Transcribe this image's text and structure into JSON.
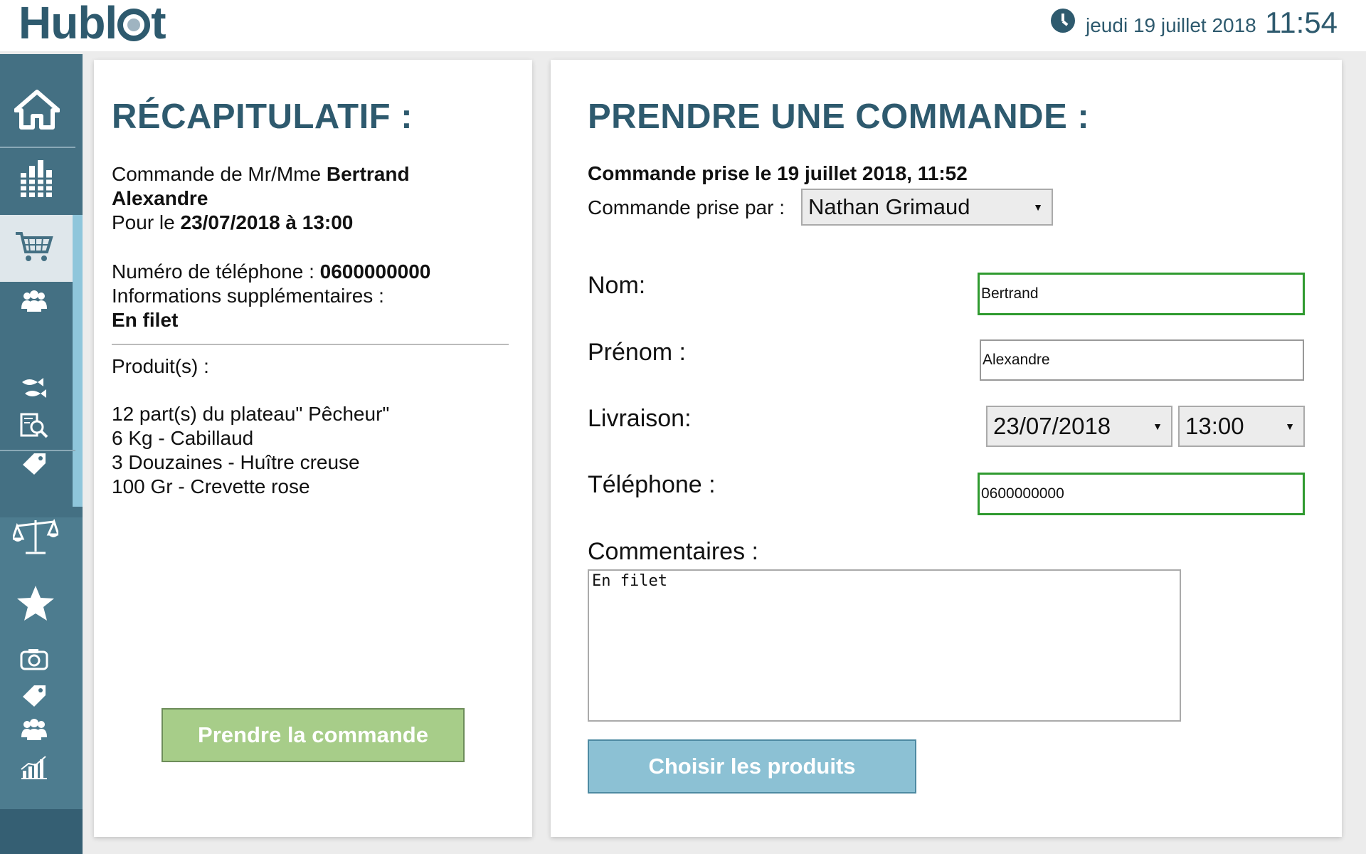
{
  "header": {
    "logo": "Hublot",
    "date": "jeudi 19 juillet 2018",
    "time": "11:54"
  },
  "sidebar": {
    "items": [
      {
        "icon": "home-icon",
        "label": "Accueil"
      },
      {
        "icon": "stats-icon",
        "label": "Statistiques"
      },
      {
        "icon": "cart-icon",
        "label": "Commandes"
      },
      {
        "icon": "clients-icon",
        "label": "Clients"
      },
      {
        "icon": "fish-icon",
        "label": "Produits"
      },
      {
        "icon": "search-doc-icon",
        "label": "Recherche"
      },
      {
        "icon": "tag-icon",
        "label": "Prix"
      },
      {
        "icon": "scale-icon",
        "label": "Balance"
      },
      {
        "icon": "star-icon",
        "label": "Favoris"
      },
      {
        "icon": "camera-icon",
        "label": "Photo"
      },
      {
        "icon": "tag2-icon",
        "label": "Étiquettes"
      },
      {
        "icon": "users-icon",
        "label": "Utilisateurs"
      },
      {
        "icon": "chart-icon",
        "label": "Graphiques"
      }
    ]
  },
  "summary": {
    "title": "RÉCAPITULATIF :",
    "order_prefix": "Commande de Mr/Mme ",
    "customer_name_line1": "Bertrand",
    "customer_name_line2": "Alexandre",
    "for_prefix": "Pour le ",
    "for_value": "23/07/2018 à 13:00",
    "phone_prefix": "Numéro de téléphone : ",
    "phone_value": "0600000000",
    "info_label": "Informations supplémentaires :",
    "info_value": "En filet",
    "products_label": "Produit(s) :",
    "products": [
      "12 part(s) du plateau\" Pêcheur\"",
      "6 Kg - Cabillaud",
      "3 Douzaines - Huître creuse",
      "100 Gr - Crevette rose"
    ],
    "submit_label": "Prendre la commande"
  },
  "form": {
    "title": "PRENDRE UNE COMMANDE :",
    "taken_on": "Commande prise le 19 juillet 2018, 11:52",
    "taken_by_label": "Commande prise par :",
    "taken_by_value": "Nathan Grimaud",
    "nom_label": "Nom:",
    "nom_value": "Bertrand",
    "prenom_label": "Prénom :",
    "prenom_value": "Alexandre",
    "livraison_label": "Livraison:",
    "livraison_date": "23/07/2018",
    "livraison_time": "13:00",
    "telephone_label": "Téléphone :",
    "telephone_value": "0600000000",
    "comments_label": "Commentaires :",
    "comments_value": "En filet",
    "choose_products_label": "Choisir les produits"
  },
  "colors": {
    "brand": "#2e5a6e",
    "sidebar": "#447083",
    "green_button": "#a7cd89",
    "blue_button": "#8cc1d4",
    "valid_border": "#2f9a2f"
  }
}
